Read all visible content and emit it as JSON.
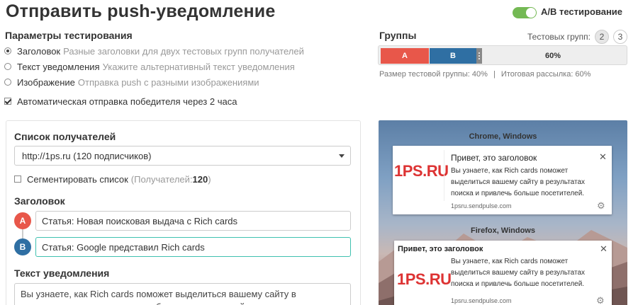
{
  "header": {
    "title": "Отправить push-уведомление",
    "ab_toggle_label": "A/B тестирование"
  },
  "test_params": {
    "heading": "Параметры тестирования",
    "options": [
      {
        "label": "Заголовок",
        "hint": "Разные заголовки для двух тестовых групп получателей",
        "selected": true
      },
      {
        "label": "Текст уведомления",
        "hint": "Укажите альтернативный текст уведомления",
        "selected": false
      },
      {
        "label": "Изображение",
        "hint": "Отправка push с разными изображениями",
        "selected": false
      }
    ],
    "auto_send_label": "Автоматическая отправка победителя через 2 часа",
    "auto_send_checked": true
  },
  "groups": {
    "heading": "Группы",
    "test_groups_label": "Тестовых групп:",
    "group_counts": [
      "2",
      "3"
    ],
    "selected_count": "2",
    "segment_a": "A",
    "segment_b": "B",
    "rest_label": "60%",
    "size_text": "Размер тестовой группы: 40%",
    "separator": "|",
    "final_text": "Итоговая рассылка: 60%",
    "colors": {
      "a": "#e8574a",
      "b": "#2f6fa3"
    }
  },
  "form": {
    "recipients_heading": "Список получателей",
    "recipients_value": "http://1ps.ru (120 подписчиков)",
    "segment_label": "Сегментировать список",
    "segment_hint_prefix": "(Получателей: ",
    "segment_count": "120",
    "segment_hint_suffix": ")",
    "title_heading": "Заголовок",
    "variant_a_letter": "A",
    "variant_a_value": "Статья: Новая поисковая выдача с Rich cards",
    "variant_b_letter": "B",
    "variant_b_value": "Статья: Google представил Rich cards",
    "text_heading": "Текст уведомления",
    "text_value": "Вы узнаете, как Rich cards поможет выделиться вашему сайту в результатах поиска и привлечь больше посетителей",
    "colors": {
      "a": "#e8574a",
      "b": "#2f6fa3",
      "active_border": "#3fc1b0"
    }
  },
  "preview": {
    "chrome": {
      "label": "Chrome, Windows",
      "logo_main": "1PS",
      "logo_suffix": ".RU",
      "title": "Привет, это заголовок",
      "body_lines": [
        "Вы узнаете, как Rich cards поможет",
        "выделиться вашему сайту в результатах",
        "поиска и привлечь больше посетителей."
      ],
      "site": "1psru.sendpulse.com"
    },
    "firefox": {
      "label": "Firefox, Windows",
      "logo_main": "1PS",
      "logo_suffix": ".RU",
      "title": "Привет, это заголовок",
      "body_lines": [
        "Вы узнаете, как Rich cards поможет",
        "выделиться вашему сайту в результатах",
        "поиска и привлечь больше посетителей."
      ],
      "site": "1psru.sendpulse.com"
    }
  }
}
